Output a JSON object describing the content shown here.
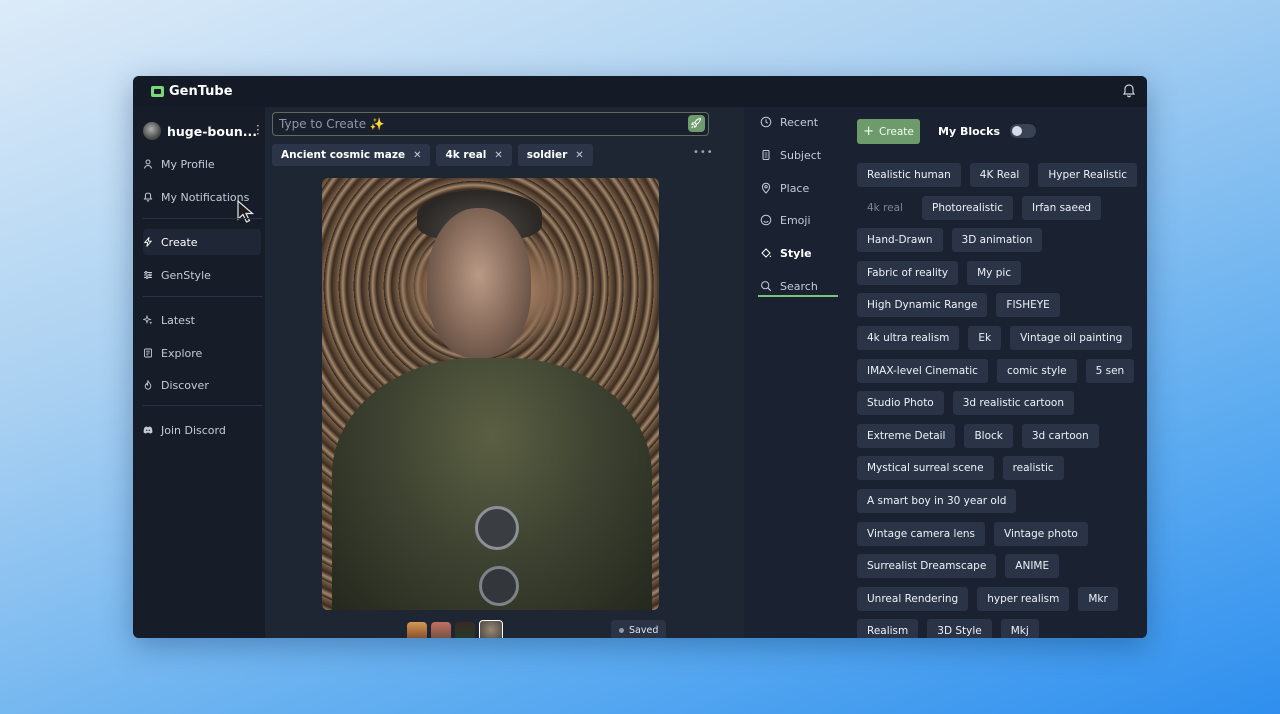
{
  "app": {
    "name": "GenTube"
  },
  "user": {
    "name": "huge-boun..."
  },
  "sidebar": {
    "items": [
      {
        "label": "My Profile",
        "icon": "user-icon"
      },
      {
        "label": "My Notifications",
        "icon": "bell-icon"
      },
      {
        "label": "Create",
        "icon": "bolt-icon",
        "active": true
      },
      {
        "label": "GenStyle",
        "icon": "sliders-icon"
      },
      {
        "label": "Latest",
        "icon": "sparkle-icon"
      },
      {
        "label": "Explore",
        "icon": "book-icon"
      },
      {
        "label": "Discover",
        "icon": "fire-icon"
      },
      {
        "label": "Join Discord",
        "icon": "discord-icon"
      }
    ]
  },
  "prompt": {
    "placeholder": "Type to Create ✨"
  },
  "tags": [
    "Ancient cosmic maze",
    "4k real",
    "soldier"
  ],
  "status": {
    "saved": "Saved"
  },
  "categories": [
    "Recent",
    "Subject",
    "Place",
    "Emoji",
    "Style",
    "Search"
  ],
  "active_category": "Style",
  "styles_panel": {
    "create_label": "Create",
    "my_blocks_label": "My Blocks",
    "my_blocks_enabled": false,
    "rows": [
      [
        "Realistic human",
        "4K Real",
        "Hyper Realistic"
      ],
      [
        "4k real",
        "Photorealistic",
        "Irfan saeed"
      ],
      [
        "Hand-Drawn",
        "3D animation"
      ],
      [
        "Fabric of reality",
        "My pic"
      ],
      [
        "High Dynamic Range",
        "FISHEYE"
      ],
      [
        "4k ultra realism",
        "Ek",
        "Vintage oil painting"
      ],
      [
        "IMAX-level Cinematic",
        "comic style",
        "5 sen"
      ],
      [
        "Studio Photo",
        "3d realistic cartoon"
      ],
      [
        "Extreme Detail",
        "Block",
        "3d cartoon"
      ],
      [
        "Mystical surreal scene",
        "realistic"
      ],
      [
        "A smart boy in 30 year old"
      ],
      [
        "Vintage camera lens",
        "Vintage photo"
      ],
      [
        "Surrealist Dreamscape",
        "ANIME"
      ],
      [
        "Unreal Rendering",
        "hyper realism",
        "Mkr"
      ],
      [
        "Realism",
        "3D Style",
        "Mkj"
      ]
    ],
    "dim_chips": [
      "4k real"
    ]
  },
  "colors": {
    "accent": "#6d9b6c",
    "window_bg": "#1a2130",
    "chip_bg": "#2a3446"
  }
}
